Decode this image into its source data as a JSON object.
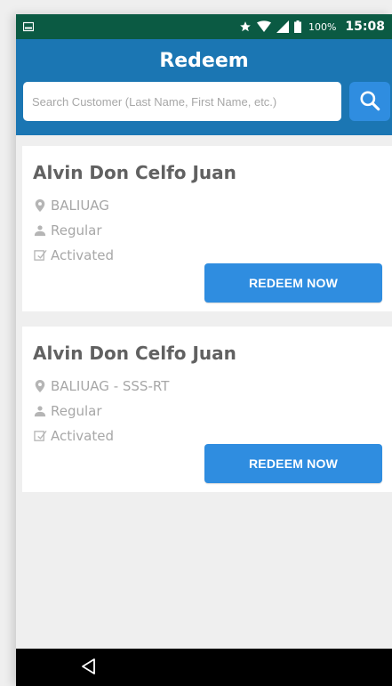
{
  "status_bar": {
    "battery_text": "100%",
    "time": "15:08",
    "icons": [
      "image-icon",
      "star-icon",
      "wifi-icon",
      "signal-icon",
      "battery-icon"
    ]
  },
  "header": {
    "title": "Redeem",
    "search": {
      "placeholder": "Search Customer (Last Name, First Name, etc.)",
      "value": ""
    }
  },
  "cards": [
    {
      "name": "Alvin Don Celfo Juan",
      "branch": "BALIUAG",
      "type": "Regular",
      "status": "Activated",
      "button_label": "REDEEM NOW"
    },
    {
      "name": "Alvin Don Celfo Juan",
      "branch": "BALIUAG - SSS-RT",
      "type": "Regular",
      "status": "Activated",
      "button_label": "REDEEM NOW"
    }
  ],
  "colors": {
    "status_bar": "#0b5a43",
    "header": "#1b76b3",
    "button": "#2f8de0",
    "background": "#efefef",
    "nav_bar": "#000000"
  }
}
